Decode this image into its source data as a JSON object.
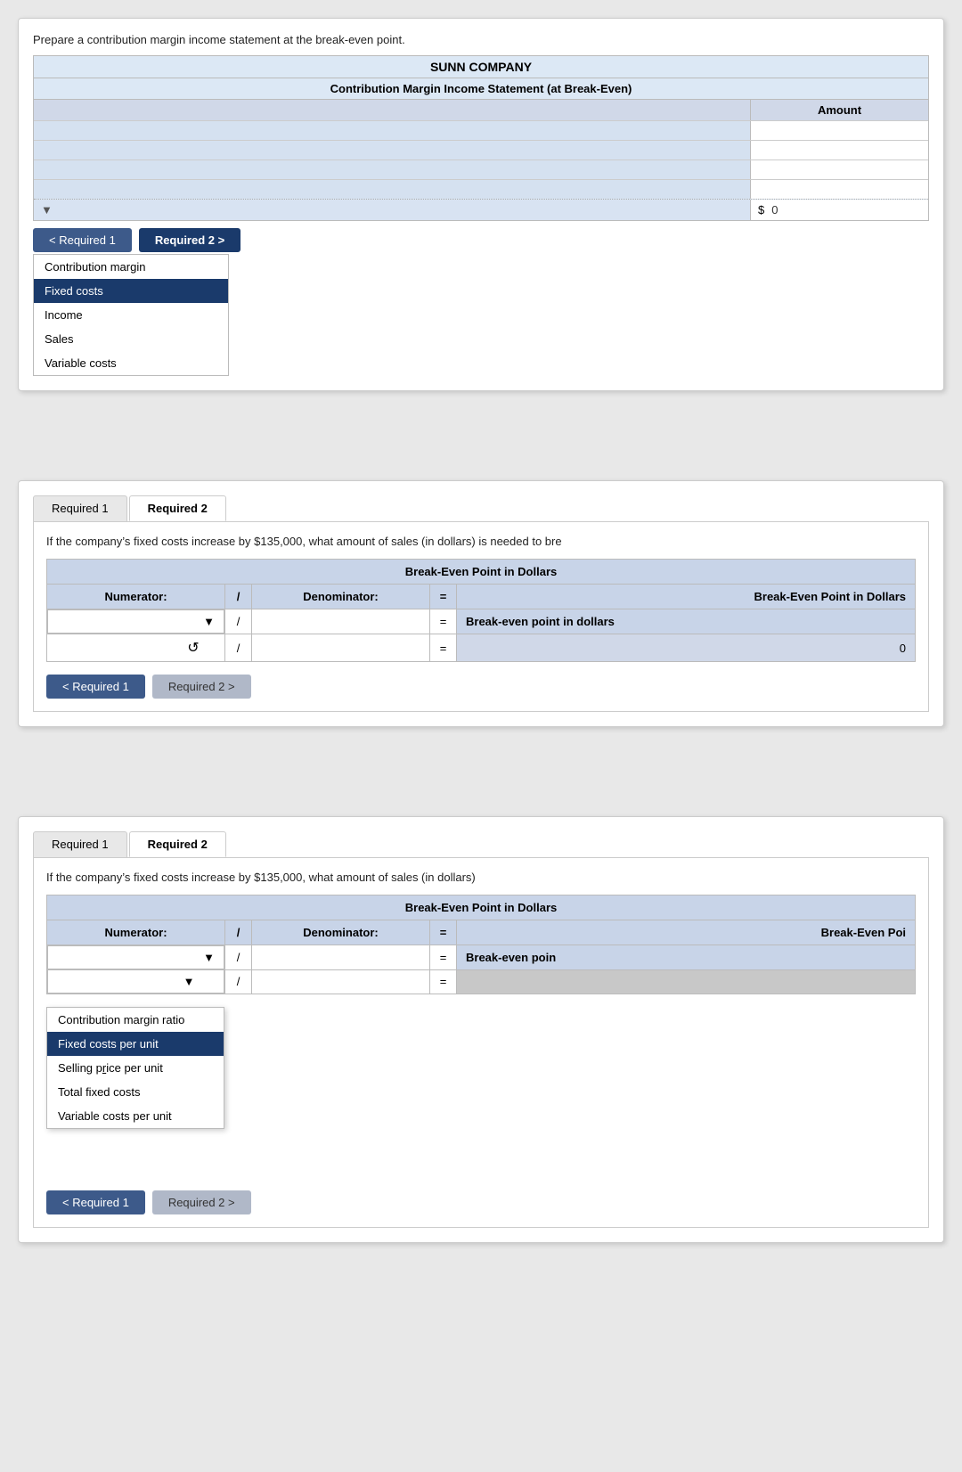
{
  "panel1": {
    "instruction": "Prepare a contribution margin income statement at the break-even point.",
    "company_name": "SUNN COMPANY",
    "statement_title": "Contribution Margin Income Statement (at Break-Even)",
    "amount_header": "Amount",
    "rows": [
      {
        "label": "",
        "value": ""
      },
      {
        "label": "",
        "value": ""
      },
      {
        "label": "",
        "value": ""
      },
      {
        "label": "",
        "value": ""
      }
    ],
    "dropdown_label": "",
    "dollar_sign": "$",
    "dollar_value": "0",
    "btn_req1_label": "< Required 1",
    "btn_req2_label": "Required 2 >",
    "dropdown_items": [
      {
        "label": "Contribution margin",
        "selected": false
      },
      {
        "label": "Fixed costs",
        "selected": true
      },
      {
        "label": "Income",
        "selected": false
      },
      {
        "label": "Sales",
        "selected": false
      },
      {
        "label": "Variable costs",
        "selected": false
      }
    ]
  },
  "panel2": {
    "tab1_label": "Required 1",
    "tab2_label": "Required 2",
    "question_text": "If the company’s fixed costs increase by $135,000, what amount of sales (in dollars) is needed to bre",
    "be_title": "Break-Even Point in Dollars",
    "numerator_label": "Numerator:",
    "slash": "/",
    "denominator_label": "Denominator:",
    "equals": "=",
    "result_header": "Break-Even Point in Dollars",
    "result_label": "Break-even point in dollars",
    "result_value": "0",
    "numerator_value": "",
    "denominator_value": "",
    "btn_req1_label": "< Required 1",
    "btn_req2_label": "Required 2 >",
    "cursor_symbol": "↺"
  },
  "panel3": {
    "tab1_label": "Required 1",
    "tab2_label": "Required 2",
    "question_text": "If the company’s fixed costs increase by $135,000, what amount of sales (in dollars)",
    "be_title": "Break-Even Point in Dollars",
    "numerator_label": "Numerator:",
    "slash": "/",
    "denominator_label": "Denominator:",
    "equals": "=",
    "result_header": "Break-Even Poi",
    "result_label": "Break-even poin",
    "numerator_value": "",
    "denominator_value": "",
    "btn_req1_label": "< Required 1",
    "btn_req2_label": "Required 2 >",
    "dropdown_items": [
      {
        "label": "Contribution margin ratio",
        "selected": false
      },
      {
        "label": "Fixed costs per unit",
        "selected": true
      },
      {
        "label": "Selling price per unit",
        "selected": false
      },
      {
        "label": "Total fixed costs",
        "selected": false
      },
      {
        "label": "Variable costs per unit",
        "selected": false
      }
    ]
  }
}
